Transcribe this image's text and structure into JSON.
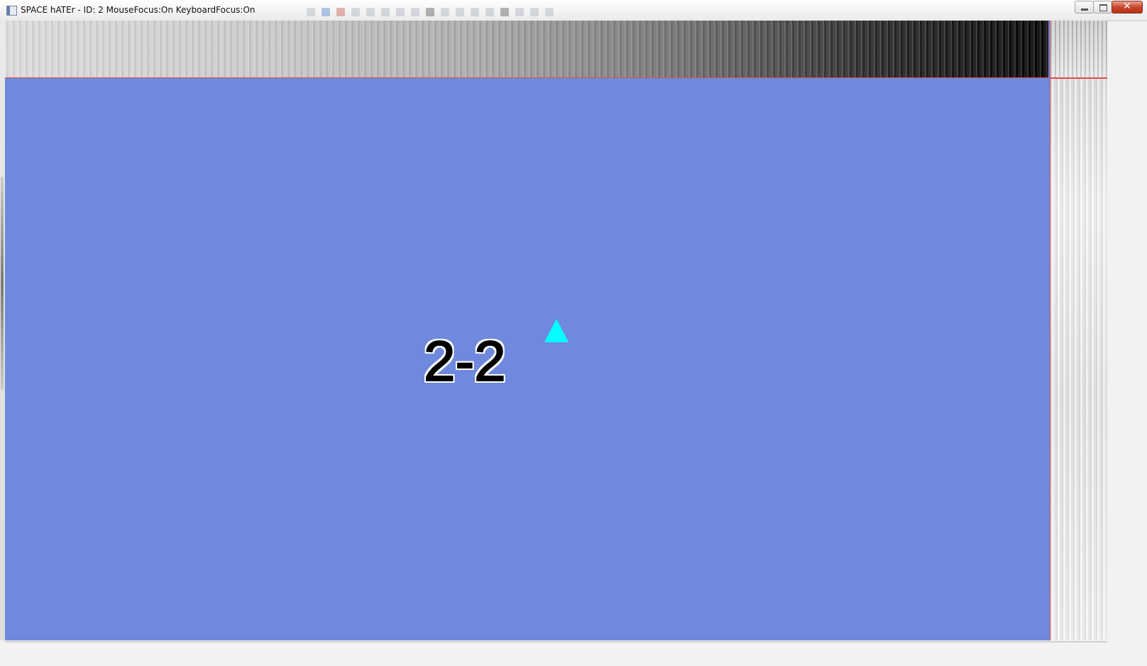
{
  "window": {
    "title": "SPACE hATEr - ID: 2 MouseFocus:On KeyboardFocus:On",
    "controls": {
      "minimize": "minimize",
      "maximize": "maximize",
      "close": "✕"
    }
  },
  "game": {
    "level_label": "2-2",
    "background_color": "#6f89de",
    "player_color": "#00ffff",
    "border_color": "#e04a4a"
  },
  "icons": [
    "app-icon",
    "minimize-icon",
    "maximize-icon",
    "close-icon",
    "player-ship-icon"
  ]
}
